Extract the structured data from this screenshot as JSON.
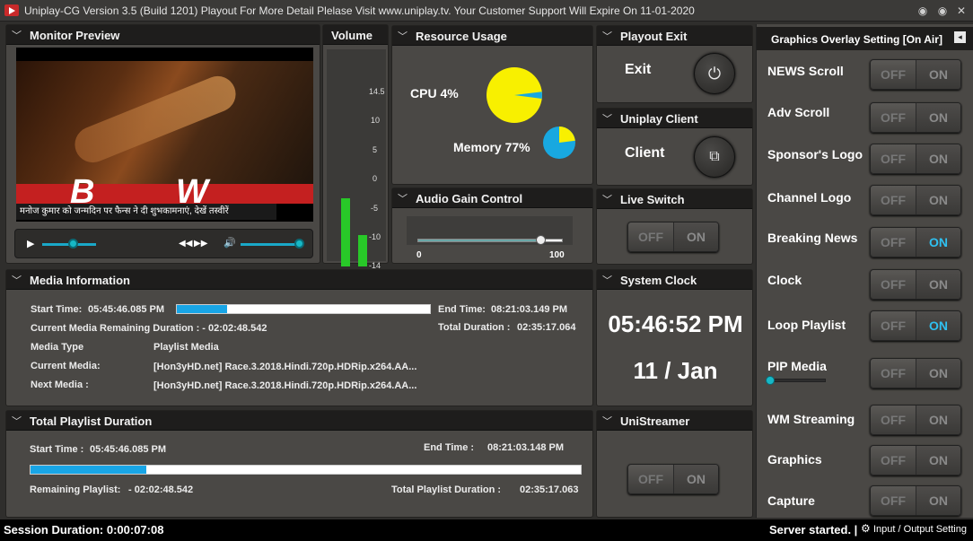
{
  "app": {
    "title": "Uniplay-CG Version 3.5 (Build 1201) Playout For More Detail Plelase Visit www.uniplay.tv. Your Customer Support Will Expire On 11-01-2020"
  },
  "monitor": {
    "title": "Monitor Preview",
    "ticker": "मनोज कुमार को जन्मदिन पर फैन्स ने दी शुभकामनाएं, देखें तस्वीरें",
    "overlay_letters": "B W"
  },
  "volume": {
    "title": "Volume",
    "scale": [
      "14.5",
      "10",
      "5",
      "0",
      "-5",
      "-10",
      "-14"
    ],
    "level_left": 0.32,
    "level_right": 0.15
  },
  "resource": {
    "title": "Resource Usage",
    "cpu_label": "CPU 4%",
    "cpu_percent": 4,
    "memory_label": "Memory 77%",
    "memory_percent": 77
  },
  "audio_gain": {
    "title": "Audio Gain Control",
    "min": "0",
    "max": "100",
    "value": 85
  },
  "playout_exit": {
    "title": "Playout Exit",
    "label": "Exit"
  },
  "uniplay_client": {
    "title": "Uniplay Client",
    "label": "Client"
  },
  "live_switch": {
    "title": "Live Switch",
    "off": "OFF",
    "on": "ON"
  },
  "system_clock": {
    "title": "System Clock",
    "time": "05:46:52 PM",
    "date": "11 / Jan"
  },
  "unistreamer": {
    "title": "UniStreamer",
    "off": "OFF",
    "on": "ON"
  },
  "media_info": {
    "title": "Media Information",
    "start_label": "Start Time:",
    "start_value": "05:45:46.085 PM",
    "end_label": "End Time:",
    "end_value": "08:21:03.149 PM",
    "progress_percent": 20,
    "remaining": "Current Media Remaining Duration : - 02:02:48.542",
    "total_label": "Total Duration :",
    "total_value": "02:35:17.064",
    "type_label": "Media Type",
    "type_value": "Playlist Media",
    "current_label": "Current Media:",
    "current_value": "[Hon3yHD.net] Race.3.2018.Hindi.720p.HDRip.x264.AA...",
    "next_label": "Next Media :",
    "next_value": "[Hon3yHD.net] Race.3.2018.Hindi.720p.HDRip.x264.AA..."
  },
  "playlist": {
    "title": "Total Playlist Duration",
    "start_label": "Start Time :",
    "start_value": "05:45:46.085 PM",
    "end_label": "End Time :",
    "end_value": "08:21:03.148 PM",
    "progress_percent": 21,
    "remaining_label": "Remaining Playlist:",
    "remaining_value": "- 02:02:48.542",
    "total_label": "Total Playlist Duration :",
    "total_value": "02:35:17.063"
  },
  "graphics": {
    "title": "Graphics Overlay Setting [On Air]",
    "off": "OFF",
    "on": "ON",
    "items": [
      {
        "label": "NEWS Scroll",
        "on": false
      },
      {
        "label": "Adv Scroll",
        "on": false
      },
      {
        "label": "Sponsor's Logo",
        "on": false
      },
      {
        "label": "Channel Logo",
        "on": false
      },
      {
        "label": "Breaking News",
        "on": true
      },
      {
        "label": "Clock",
        "on": false
      },
      {
        "label": "Loop Playlist",
        "on": true
      },
      {
        "label": "PIP Media",
        "on": false
      },
      {
        "label": "WM Streaming",
        "on": false
      },
      {
        "label": "Graphics",
        "on": false
      },
      {
        "label": "Capture",
        "on": false
      }
    ]
  },
  "status": {
    "session": "Session Duration: 0:00:07:08",
    "server": "Server started. |",
    "io": "Input / Output Setting"
  }
}
